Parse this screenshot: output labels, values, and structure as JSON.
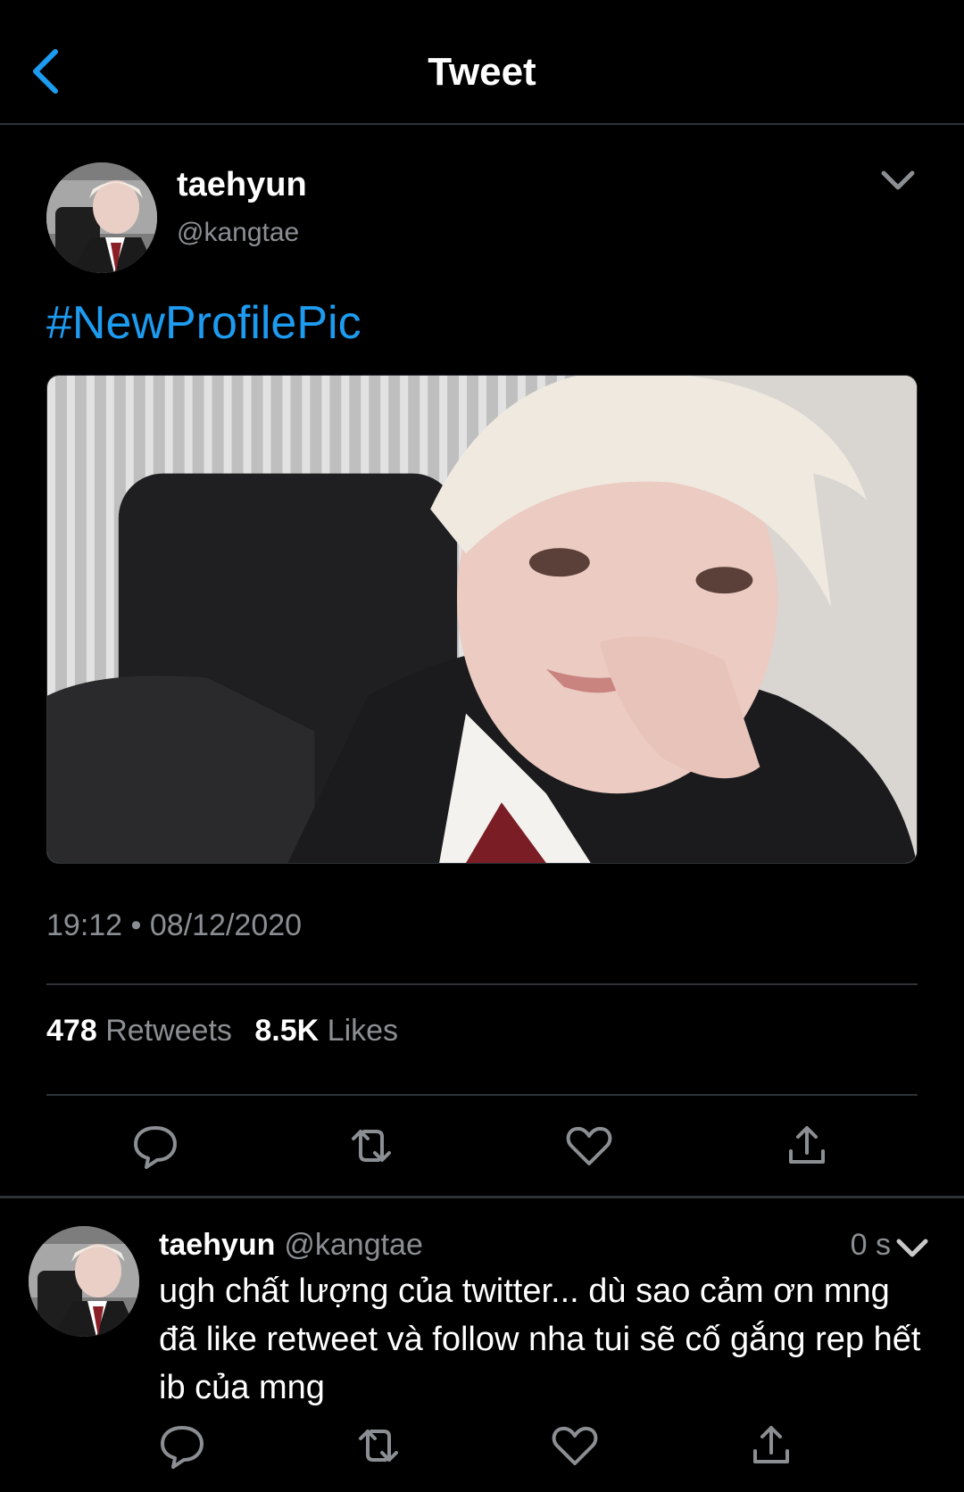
{
  "header": {
    "title": "Tweet",
    "back_icon": "chevron-left-icon"
  },
  "tweet": {
    "name": "taehyun",
    "handle": "@kangtae",
    "hashtag": "#NewProfilePic",
    "timestamp": "19:12 • 08/12/2020",
    "retweets_count": "478",
    "retweets_label": "Retweets",
    "likes_count": "8.5K",
    "likes_label": "Likes",
    "actions": [
      "reply-icon",
      "retweet-icon",
      "like-icon",
      "share-icon"
    ]
  },
  "reply": {
    "name": "taehyun",
    "handle": "@kangtae",
    "time": "0 s",
    "text": "ugh chất lượng của twitter... dù sao cảm ơn mng đã like retweet và follow nha tui sẽ cố gắng rep hết ib của mng",
    "actions": [
      "reply-icon",
      "retweet-icon",
      "like-icon",
      "share-icon"
    ]
  },
  "colors": {
    "accent": "#1d9bf0",
    "muted": "#8b8f93",
    "divider": "#2f3336",
    "background": "#000000"
  }
}
